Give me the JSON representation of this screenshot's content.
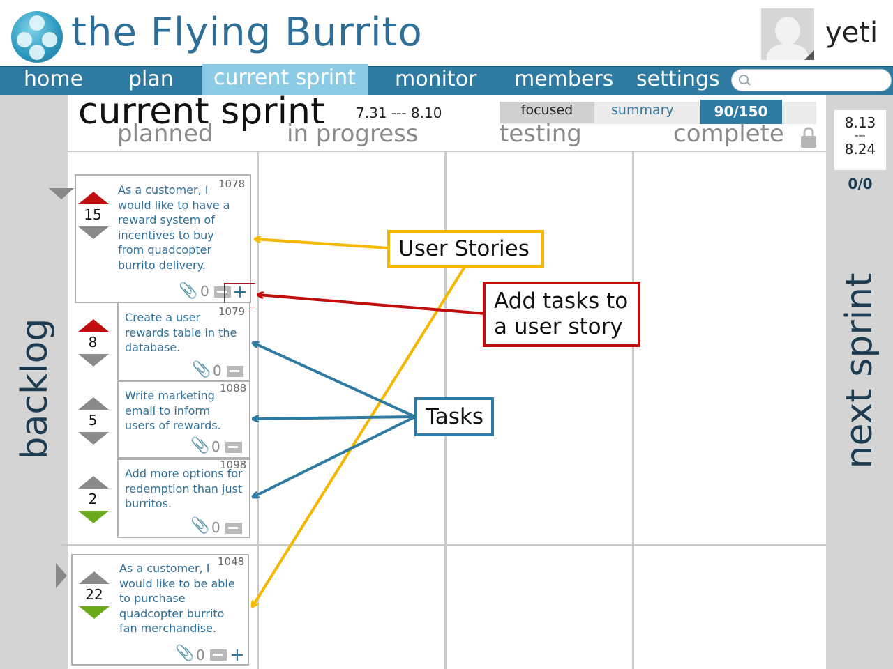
{
  "app": {
    "title": "the Flying Burrito",
    "username": "yeti"
  },
  "nav": {
    "items": [
      {
        "label": "home"
      },
      {
        "label": "plan"
      },
      {
        "label": "current sprint",
        "active": true
      },
      {
        "label": "monitor"
      },
      {
        "label": "members"
      },
      {
        "label": "settings"
      }
    ],
    "search_placeholder": ""
  },
  "page": {
    "title": "current sprint",
    "dates": "7.31 --- 8.10",
    "columns": [
      "planned",
      "in progress",
      "testing",
      "complete"
    ],
    "view_toggle": {
      "focused": "focused",
      "summary": "summary",
      "active": "focused"
    },
    "points": "90/150"
  },
  "backlog": {
    "label": "backlog"
  },
  "next_sprint": {
    "label": "next sprint",
    "date_start": "8.13",
    "date_sep": "---",
    "date_end": "8.24",
    "points": "0/0"
  },
  "stories": [
    {
      "id": "1078",
      "points": "15",
      "text": "As a customer, I would like to have a reward system of incentives to buy from quadcopter burrito delivery.",
      "attachments": "0",
      "tasks": [
        {
          "id": "1079",
          "points": "8",
          "text": "Create a user rewards table in the database.",
          "attachments": "0"
        },
        {
          "id": "1088",
          "points": "5",
          "text": "Write marketing email to inform users of rewards.",
          "attachments": "0"
        },
        {
          "id": "1098",
          "points": "2",
          "text": "Add more options for redemption than just burritos.",
          "attachments": "0"
        }
      ]
    },
    {
      "id": "1048",
      "points": "22",
      "text": "As a customer, I would like to be able to purchase quadcopter burrito fan merchandise.",
      "attachments": "0",
      "tasks": []
    }
  ],
  "callouts": {
    "user_stories": "User Stories",
    "add_tasks_line1": "Add tasks to",
    "add_tasks_line2": "a user story",
    "tasks": "Tasks",
    "colors": {
      "user_stories": "#f5b700",
      "add_tasks": "#c00d0d",
      "tasks": "#2e7aa1"
    }
  },
  "colors": {
    "nav": "#2e7aa1",
    "nav_active": "#8ccbe6",
    "vote_up_active": "#c00d0d",
    "vote_down_active": "#6aaa1a",
    "panel": "#d4d4d4"
  }
}
